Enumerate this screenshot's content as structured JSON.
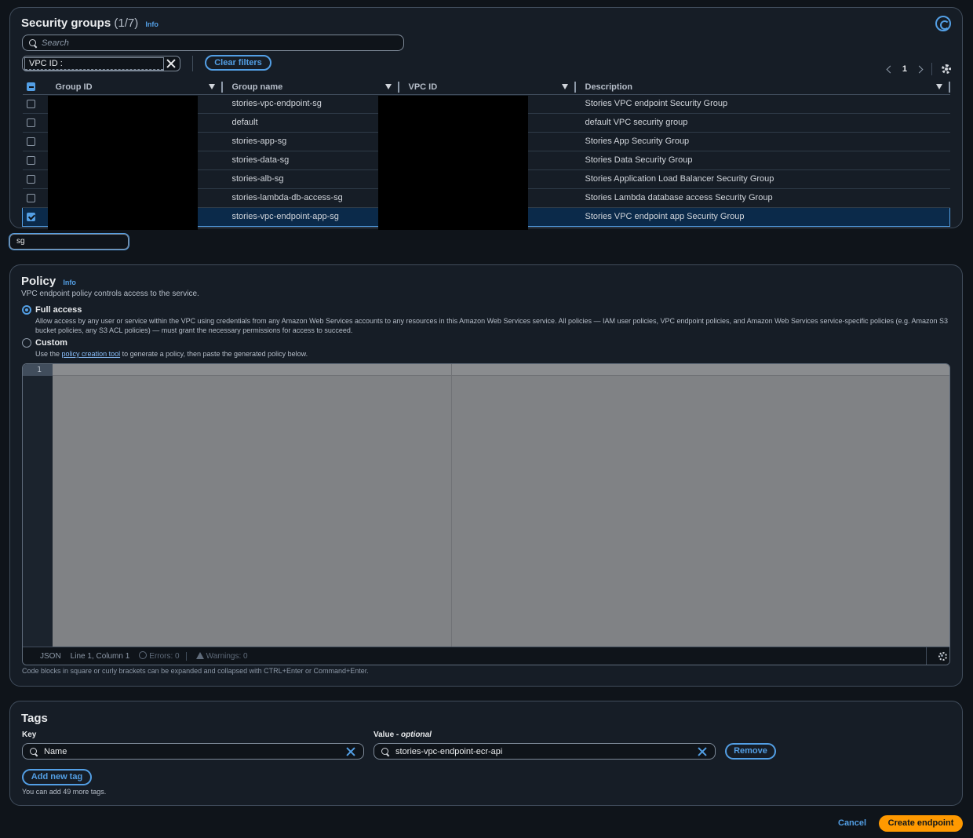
{
  "security_groups": {
    "title": "Security groups",
    "count": "(1/7)",
    "info": "Info",
    "search_placeholder": "Search",
    "filter_token": "VPC ID :",
    "clear_filters": "Clear filters",
    "page": "1",
    "columns": [
      "Group ID",
      "Group name",
      "VPC ID",
      "Description"
    ],
    "rows": [
      {
        "name": "stories-vpc-endpoint-sg",
        "description": "Stories VPC endpoint Security Group",
        "checked": false
      },
      {
        "name": "default",
        "description": "default VPC security group",
        "checked": false
      },
      {
        "name": "stories-app-sg",
        "description": "Stories App Security Group",
        "checked": false
      },
      {
        "name": "stories-data-sg",
        "description": "Stories Data Security Group",
        "checked": false
      },
      {
        "name": "stories-alb-sg",
        "description": "Stories Application Load Balancer Security Group",
        "checked": false
      },
      {
        "name": "stories-lambda-db-access-sg",
        "description": "Stories Lambda database access Security Group",
        "checked": false
      },
      {
        "name": "stories-vpc-endpoint-app-sg",
        "description": "Stories VPC endpoint app Security Group",
        "checked": true
      }
    ],
    "text_input_value": "sg"
  },
  "policy": {
    "title": "Policy",
    "info": "Info",
    "description": "VPC endpoint policy controls access to the service.",
    "full_access_label": "Full access",
    "full_access_desc": "Allow access by any user or service within the VPC using credentials from any Amazon Web Services accounts to any resources in this Amazon Web Services service. All policies — IAM user policies, VPC endpoint policies, and Amazon Web Services service-specific policies (e.g. Amazon S3 bucket policies, any S3 ACL policies) — must grant the necessary permissions for access to succeed.",
    "custom_label": "Custom",
    "custom_desc_prefix": "Use the",
    "custom_desc_link": "policy creation tool",
    "custom_desc_suffix": "to generate a policy, then paste the generated policy below.",
    "editor": {
      "line_number": "1",
      "language": "JSON",
      "position": "Line 1, Column 1",
      "errors": "Errors: 0",
      "warnings": "Warnings: 0"
    },
    "hint": "Code blocks in square or curly brackets can be expanded and collapsed with CTRL+Enter or Command+Enter."
  },
  "tags": {
    "title": "Tags",
    "key_label": "Key",
    "value_label": "Value -",
    "value_optional": "optional",
    "key_value": "Name",
    "value_value": "stories-vpc-endpoint-ecr-api",
    "remove": "Remove",
    "add_new_tag": "Add new tag",
    "more_tags": "You can add 49 more tags."
  },
  "footer": {
    "cancel": "Cancel",
    "create": "Create endpoint"
  },
  "colors": {
    "accent": "#539fe5",
    "primary": "#ff9900",
    "background": "#0f141a"
  }
}
